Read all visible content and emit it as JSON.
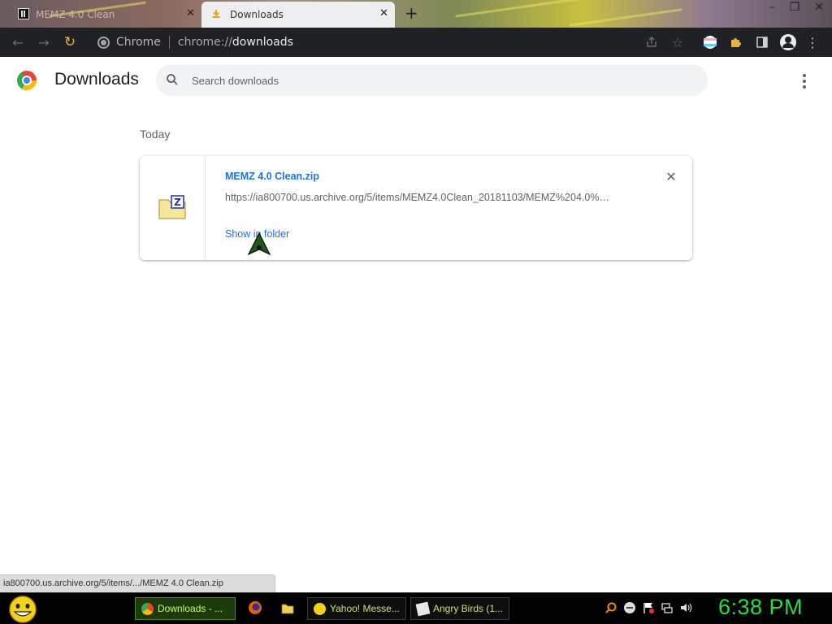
{
  "tabs": [
    {
      "title": "MEMZ 4.0 Clean",
      "active": false
    },
    {
      "title": "Downloads",
      "active": true
    }
  ],
  "toolbar": {
    "omnibox_site": "Chrome",
    "url_scheme": "chrome://",
    "url_host": "downloads"
  },
  "page": {
    "title": "Downloads",
    "search_placeholder": "Search downloads",
    "section_label": "Today",
    "download": {
      "file_name": "MEMZ 4.0 Clean.zip",
      "url": "https://ia800700.us.archive.org/5/items/MEMZ4.0Clean_20181103/MEMZ%204.0%…",
      "action_label": "Show in folder"
    }
  },
  "status_bubble": "ia800700.us.archive.org/5/items/.../MEMZ 4.0 Clean.zip",
  "taskbar": {
    "buttons": [
      {
        "label": "Downloads - ...",
        "active": true
      },
      {
        "label": "Yahoo! Messe...",
        "active": false
      },
      {
        "label": "Angry Birds (1...",
        "active": false
      }
    ],
    "clock": "6:38 PM"
  },
  "colors": {
    "link_blue": "#1a73e8",
    "toolbar_dark": "#202124",
    "clock_green": "#23e038"
  }
}
